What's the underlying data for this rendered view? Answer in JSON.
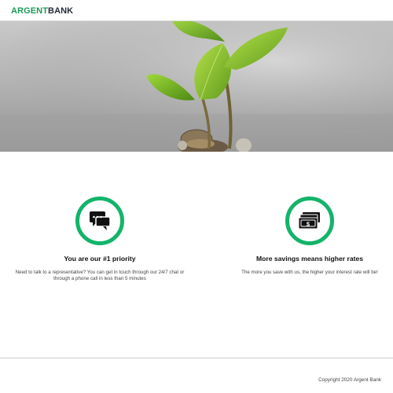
{
  "nav": {
    "brand_part1": "ARGENT",
    "brand_part2": "BANK",
    "brand_color": "#1c9a57"
  },
  "hero": {
    "image": "plant-growing-from-coins"
  },
  "features": [
    {
      "icon": "chat-bubbles-icon",
      "title": "You are our #1 priority",
      "text": "Need to talk to a representative? You can get in touch through our 24/7 chat or through a phone call in less than 5 minutes"
    },
    {
      "icon": "money-bills-icon",
      "title": "More savings means higher rates",
      "text": "The more you save with us, the higher your interest rate will be!"
    }
  ],
  "accent_color": "#13b46a",
  "footer": {
    "copyright": "Copyright 2020 Argent Bank"
  }
}
